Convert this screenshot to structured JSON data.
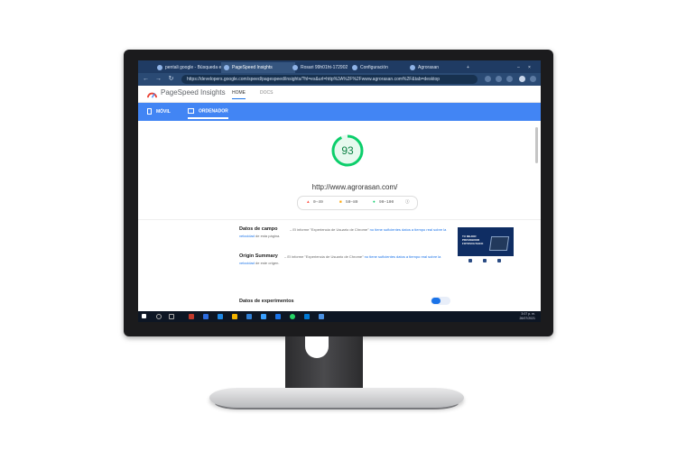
{
  "tabs": [
    {
      "label": "pentali google - Búsqueda e"
    },
    {
      "label": "PageSpeed Insights"
    },
    {
      "label": "Rosari 99h01ht-172902"
    },
    {
      "label": "Configuración"
    },
    {
      "label": "Agrorasan"
    }
  ],
  "address": {
    "url": "https://developers.google.com/speed/pagespeed/insights/?hl=es&url=http%3A%2F%2Fwww.agrorasan.com%2F&tab=desktop"
  },
  "psi": {
    "title": "PageSpeed Insights",
    "tab_home": "HOME",
    "tab_docs": "DOCS",
    "device_mobile": "MÓVIL",
    "device_desktop": "ORDENADOR",
    "score": "93",
    "score_fraction": 0.93,
    "site": "http://www.agrorasan.com/",
    "legend_low": "0–49",
    "legend_mid": "50–89",
    "legend_high": "90–100",
    "field_title": "Datos de campo",
    "field_pre": "– El informe \"Experiencia de Usuario de Chrome\"",
    "field_link": "no tiene suficientes datos a tiempo real sobre la velocidad",
    "field_post": "de esta página.",
    "origin_title": "Origin Summary",
    "origin_pre": "– El informe \"Experiencia de Usuario de Chrome\"",
    "origin_link": "no tiene suficientes datos a tiempo real sobre la velocidad",
    "origin_post": "de este origen.",
    "lab_title": "Datos de experimentos",
    "thumb_text": "TU MEJOR PROVEEDOR FOTOVOLTAICO"
  },
  "taskbar": {
    "time": "3:07 p. m.",
    "date": "26/07/2021"
  },
  "colors": {
    "accent": "#4285f4",
    "score_good": "#0cce6b",
    "tabbar": "#1f3b63",
    "bezel": "#1b1b1d"
  }
}
